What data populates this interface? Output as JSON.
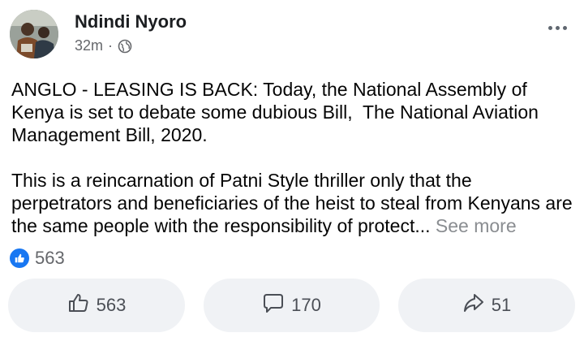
{
  "post": {
    "author": "Ndindi Nyoro",
    "time": "32m",
    "separator": "·",
    "paragraphs": [
      "ANGLO - LEASING IS BACK: Today, the National Assembly of Kenya is set to debate some dubious Bill,  The National Aviation Management Bill, 2020.",
      "This is a reincarnation of Patni Style thriller only that the perpetrators and beneficiaries of the heist to steal from Kenyans are the same people with the responsibility of protect..."
    ],
    "see_more": "See more",
    "reaction_count": "563"
  },
  "actions": {
    "like_count": "563",
    "comment_count": "170",
    "share_count": "51"
  },
  "colors": {
    "accent": "#1877f2",
    "muted": "#65676b",
    "button_bg": "#f0f2f5"
  },
  "icons": [
    "globe-icon",
    "more-options-icon",
    "like-icon",
    "comment-icon",
    "share-icon"
  ]
}
